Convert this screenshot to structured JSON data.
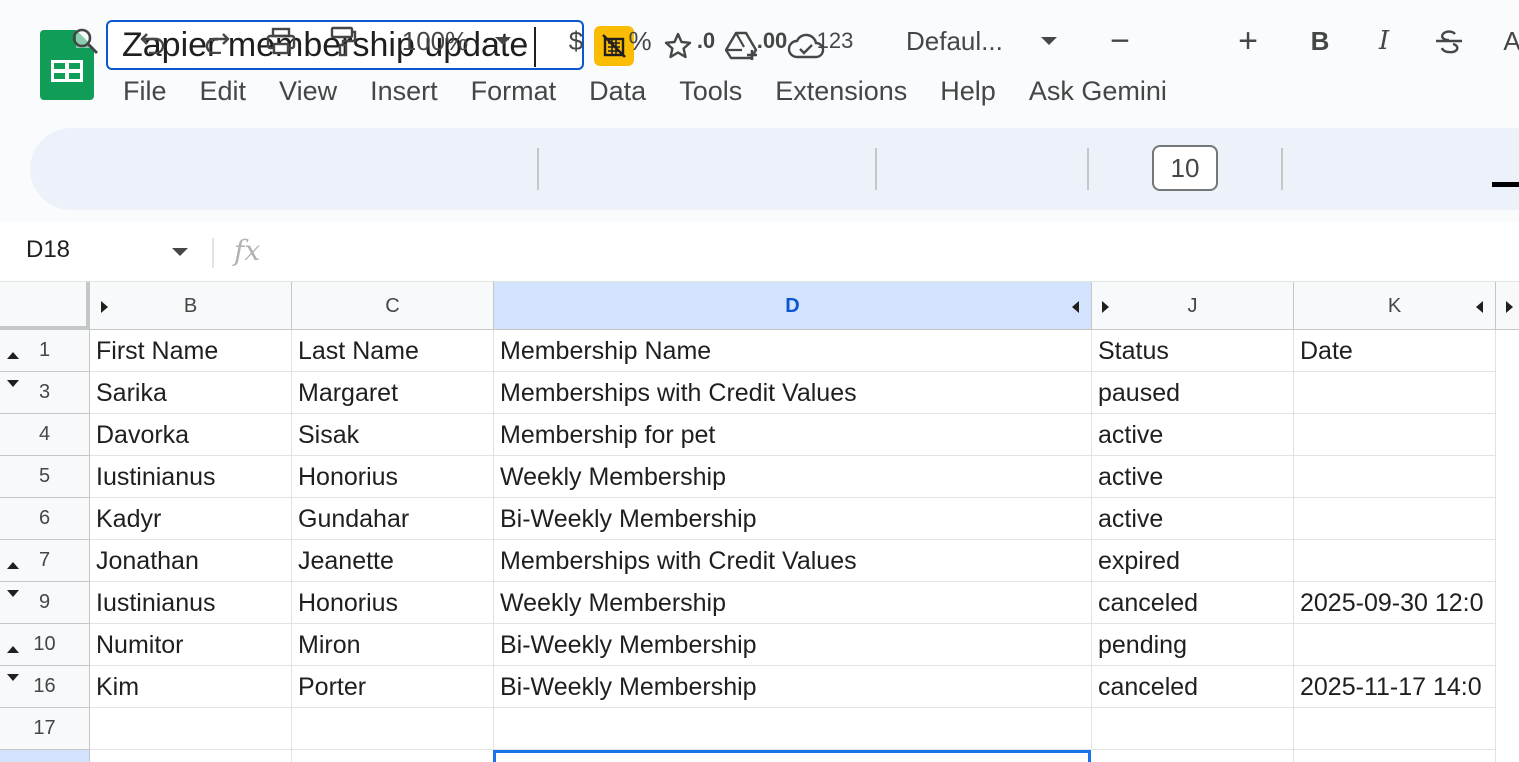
{
  "document": {
    "title": "Zapier membership update"
  },
  "menu": [
    "File",
    "Edit",
    "View",
    "Insert",
    "Format",
    "Data",
    "Tools",
    "Extensions",
    "Help",
    "Ask Gemini"
  ],
  "toolbar": {
    "zoom": "100%",
    "currency": "$",
    "percent": "%",
    "decrease_decimal": ".0",
    "increase_decimal": ".00",
    "number_format": "123",
    "font": "Defaul...",
    "font_size": "10",
    "minus": "−",
    "plus": "+",
    "bold": "B",
    "italic": "I",
    "text_color": "A"
  },
  "formula_bar": {
    "cell_ref": "D18",
    "fx": "fx",
    "value": ""
  },
  "columns": [
    "B",
    "C",
    "D",
    "J",
    "K"
  ],
  "selected_column": "D",
  "rows": [
    {
      "num": "1",
      "b": "First Name",
      "c": "Last Name",
      "d": "Membership Name",
      "j": "Status",
      "k": "Date"
    },
    {
      "num": "3",
      "b": "Sarika",
      "c": "Margaret",
      "d": "Memberships with Credit Values",
      "j": "paused",
      "k": ""
    },
    {
      "num": "4",
      "b": "Davorka",
      "c": "Sisak",
      "d": "Membership for pet",
      "j": "active",
      "k": ""
    },
    {
      "num": "5",
      "b": "Iustinianus",
      "c": "Honorius",
      "d": "Weekly Membership",
      "j": "active",
      "k": ""
    },
    {
      "num": "6",
      "b": "Kadyr",
      "c": "Gundahar",
      "d": "Bi-Weekly Membership",
      "j": "active",
      "k": ""
    },
    {
      "num": "7",
      "b": "Jonathan",
      "c": "Jeanette",
      "d": "Memberships with Credit Values",
      "j": "expired",
      "k": ""
    },
    {
      "num": "9",
      "b": "Iustinianus",
      "c": "Honorius",
      "d": "Weekly Membership",
      "j": "canceled",
      "k": "2025-09-30 12:0"
    },
    {
      "num": "10",
      "b": "Numitor",
      "c": "Miron",
      "d": "Bi-Weekly Membership",
      "j": "pending",
      "k": ""
    },
    {
      "num": "16",
      "b": "Kim",
      "c": "Porter",
      "d": "Bi-Weekly Membership",
      "j": "canceled",
      "k": "2025-11-17 14:0"
    },
    {
      "num": "17",
      "b": "",
      "c": "",
      "d": "",
      "j": "",
      "k": ""
    }
  ],
  "colors": {
    "accent": "#0b57d0",
    "selection": "#d3e3fd",
    "sheets_green": "#0f9d58"
  }
}
